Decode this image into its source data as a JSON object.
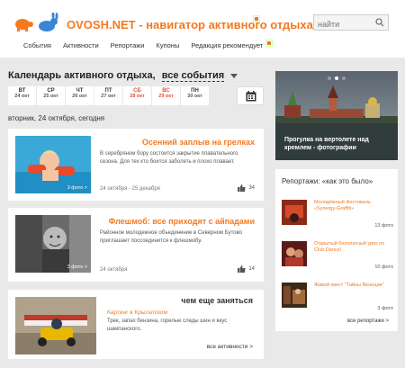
{
  "header": {
    "domain": "OVOSH.NET",
    "separator": "-",
    "tagline": "навигатор активного отдыха",
    "search_placeholder": "найти",
    "nav": [
      "События",
      "Активности",
      "Репортажи",
      "Купоны",
      "Редакция рекомендует"
    ]
  },
  "calendar": {
    "title": "Календарь активного отдыха,",
    "filter": "все события",
    "days": [
      {
        "name": "ВТ",
        "date": "24 окт",
        "weekend": false
      },
      {
        "name": "СР",
        "date": "25 окт",
        "weekend": false
      },
      {
        "name": "ЧТ",
        "date": "26 окт",
        "weekend": false
      },
      {
        "name": "ПТ",
        "date": "27 окт",
        "weekend": false
      },
      {
        "name": "СБ",
        "date": "28 окт",
        "weekend": true
      },
      {
        "name": "ВС",
        "date": "29 окт",
        "weekend": true
      },
      {
        "name": "ПН",
        "date": "30 окт",
        "weekend": false
      }
    ],
    "today_line": "вторник, 24 октября, сегодня"
  },
  "events": [
    {
      "title": "Осенний заплыв на грелках",
      "description": "В серебряном бору состоится закрытие плавательного сезона. Для тех кто боится заболеть и плохо плавает.",
      "photos": "3 фото >",
      "dates": "24 октября - 25 декабря",
      "likes": "34"
    },
    {
      "title": "Флешмоб: все приходят с айпадами",
      "description": "Районное молодежное объединение в Северном Бутово приглашает поссоединится к флешмобу.",
      "photos": "3 фото >",
      "dates": "24 октября",
      "likes": "14"
    }
  ],
  "more": {
    "title": "чем еще заняться",
    "link": "Картинг в Крылатском",
    "description": "Трек, запах бензина, горелые следы шин и вкус шампанского.",
    "all_link": "все активности >"
  },
  "banner": {
    "text": "Прогулка на вертолете над кремлем - фотографии"
  },
  "reports": {
    "title": "Репортажи: «как это было»",
    "items": [
      {
        "label": "Молодёжный Фестиваль «Synergy-Graffiti»",
        "count": "13 фото"
      },
      {
        "label": "Открытый бесплатный урок по Club Dance!",
        "count": "10 фото"
      },
      {
        "label": "Живой квест \"Тайны Венеции\"",
        "count": "3 фото"
      }
    ],
    "all_link": "все репортажи >"
  },
  "colors": {
    "accent": "#f47920",
    "background": "#e9e9e9",
    "weekend": "#e74c3c"
  }
}
